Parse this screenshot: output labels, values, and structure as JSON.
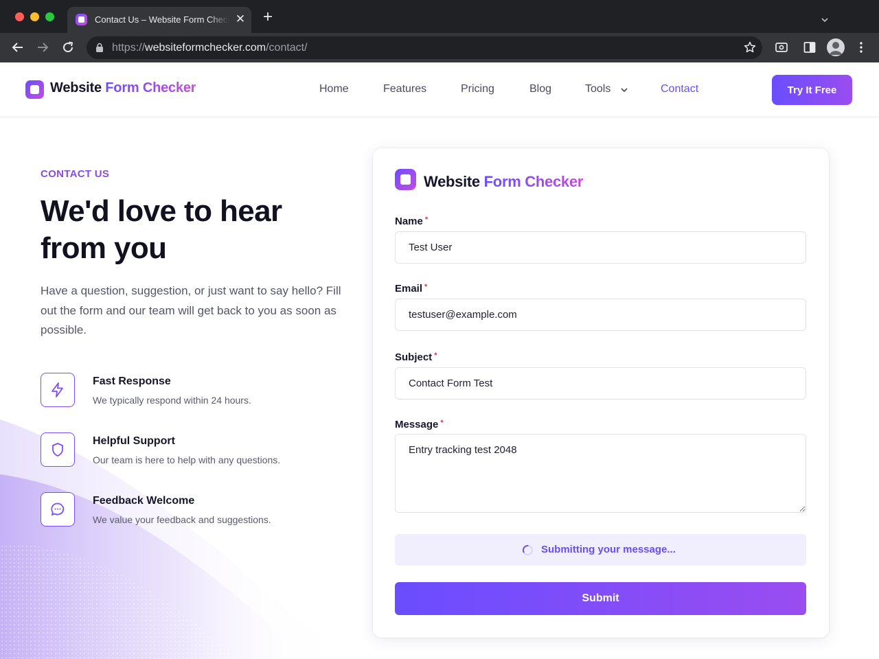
{
  "browser": {
    "tab_title": "Contact Us – Website Form Checker",
    "new_tab_label": "+",
    "url_scheme": "https://",
    "url_host": "websiteformchecker.com",
    "url_path": "/contact/"
  },
  "nav": {
    "logo_primary": "Website ",
    "logo_accent": "Form Checker",
    "links": [
      "Home",
      "Features",
      "Pricing",
      "Blog",
      "Tools",
      "Contact"
    ],
    "active_link": "Contact",
    "cta_label": "Try It Free"
  },
  "hero": {
    "eyebrow": "CONTACT US",
    "title": "We'd love to hear from you",
    "description": "Have a question, suggestion, or just want to say hello? Fill out the form and our team will get back to you as soon as possible."
  },
  "features": [
    {
      "icon": "lightning-icon",
      "title": "Fast Response",
      "description": "We typically respond within 24 hours."
    },
    {
      "icon": "shield-icon",
      "title": "Helpful Support",
      "description": "Our team is here to help with any questions."
    },
    {
      "icon": "chat-bubble-icon",
      "title": "Feedback Welcome",
      "description": "We value your feedback and suggestions."
    }
  ],
  "form": {
    "logo_primary": "Website ",
    "logo_accent": "Form Checker",
    "required_marker": "*",
    "fields": {
      "name": {
        "label": "Name",
        "value": "Test User"
      },
      "email": {
        "label": "Email",
        "value": "testuser@example.com"
      },
      "subject": {
        "label": "Subject",
        "value": "Contact Form Test"
      },
      "message": {
        "label": "Message",
        "value": "Entry tracking test 2048"
      }
    },
    "status_text": "Submitting your message...",
    "submit_label": "Submit"
  },
  "colors": {
    "brand_purple": "#6a4dff",
    "brand_magenta": "#c64ce0",
    "required_red": "#e0334d"
  }
}
